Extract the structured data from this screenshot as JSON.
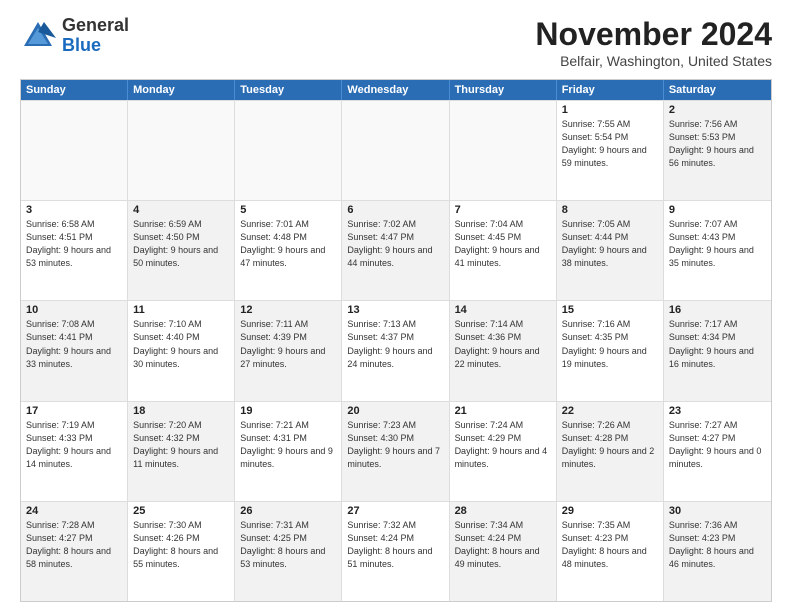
{
  "logo": {
    "general": "General",
    "blue": "Blue"
  },
  "title": "November 2024",
  "subtitle": "Belfair, Washington, United States",
  "days_of_week": [
    "Sunday",
    "Monday",
    "Tuesday",
    "Wednesday",
    "Thursday",
    "Friday",
    "Saturday"
  ],
  "weeks": [
    [
      {
        "day": "",
        "info": "",
        "empty": true
      },
      {
        "day": "",
        "info": "",
        "empty": true
      },
      {
        "day": "",
        "info": "",
        "empty": true
      },
      {
        "day": "",
        "info": "",
        "empty": true
      },
      {
        "day": "",
        "info": "",
        "empty": true
      },
      {
        "day": "1",
        "info": "Sunrise: 7:55 AM\nSunset: 5:54 PM\nDaylight: 9 hours and 59 minutes.",
        "alt": false
      },
      {
        "day": "2",
        "info": "Sunrise: 7:56 AM\nSunset: 5:53 PM\nDaylight: 9 hours and 56 minutes.",
        "alt": true
      }
    ],
    [
      {
        "day": "3",
        "info": "Sunrise: 6:58 AM\nSunset: 4:51 PM\nDaylight: 9 hours and 53 minutes.",
        "alt": false
      },
      {
        "day": "4",
        "info": "Sunrise: 6:59 AM\nSunset: 4:50 PM\nDaylight: 9 hours and 50 minutes.",
        "alt": true
      },
      {
        "day": "5",
        "info": "Sunrise: 7:01 AM\nSunset: 4:48 PM\nDaylight: 9 hours and 47 minutes.",
        "alt": false
      },
      {
        "day": "6",
        "info": "Sunrise: 7:02 AM\nSunset: 4:47 PM\nDaylight: 9 hours and 44 minutes.",
        "alt": true
      },
      {
        "day": "7",
        "info": "Sunrise: 7:04 AM\nSunset: 4:45 PM\nDaylight: 9 hours and 41 minutes.",
        "alt": false
      },
      {
        "day": "8",
        "info": "Sunrise: 7:05 AM\nSunset: 4:44 PM\nDaylight: 9 hours and 38 minutes.",
        "alt": true
      },
      {
        "day": "9",
        "info": "Sunrise: 7:07 AM\nSunset: 4:43 PM\nDaylight: 9 hours and 35 minutes.",
        "alt": false
      }
    ],
    [
      {
        "day": "10",
        "info": "Sunrise: 7:08 AM\nSunset: 4:41 PM\nDaylight: 9 hours and 33 minutes.",
        "alt": true
      },
      {
        "day": "11",
        "info": "Sunrise: 7:10 AM\nSunset: 4:40 PM\nDaylight: 9 hours and 30 minutes.",
        "alt": false
      },
      {
        "day": "12",
        "info": "Sunrise: 7:11 AM\nSunset: 4:39 PM\nDaylight: 9 hours and 27 minutes.",
        "alt": true
      },
      {
        "day": "13",
        "info": "Sunrise: 7:13 AM\nSunset: 4:37 PM\nDaylight: 9 hours and 24 minutes.",
        "alt": false
      },
      {
        "day": "14",
        "info": "Sunrise: 7:14 AM\nSunset: 4:36 PM\nDaylight: 9 hours and 22 minutes.",
        "alt": true
      },
      {
        "day": "15",
        "info": "Sunrise: 7:16 AM\nSunset: 4:35 PM\nDaylight: 9 hours and 19 minutes.",
        "alt": false
      },
      {
        "day": "16",
        "info": "Sunrise: 7:17 AM\nSunset: 4:34 PM\nDaylight: 9 hours and 16 minutes.",
        "alt": true
      }
    ],
    [
      {
        "day": "17",
        "info": "Sunrise: 7:19 AM\nSunset: 4:33 PM\nDaylight: 9 hours and 14 minutes.",
        "alt": false
      },
      {
        "day": "18",
        "info": "Sunrise: 7:20 AM\nSunset: 4:32 PM\nDaylight: 9 hours and 11 minutes.",
        "alt": true
      },
      {
        "day": "19",
        "info": "Sunrise: 7:21 AM\nSunset: 4:31 PM\nDaylight: 9 hours and 9 minutes.",
        "alt": false
      },
      {
        "day": "20",
        "info": "Sunrise: 7:23 AM\nSunset: 4:30 PM\nDaylight: 9 hours and 7 minutes.",
        "alt": true
      },
      {
        "day": "21",
        "info": "Sunrise: 7:24 AM\nSunset: 4:29 PM\nDaylight: 9 hours and 4 minutes.",
        "alt": false
      },
      {
        "day": "22",
        "info": "Sunrise: 7:26 AM\nSunset: 4:28 PM\nDaylight: 9 hours and 2 minutes.",
        "alt": true
      },
      {
        "day": "23",
        "info": "Sunrise: 7:27 AM\nSunset: 4:27 PM\nDaylight: 9 hours and 0 minutes.",
        "alt": false
      }
    ],
    [
      {
        "day": "24",
        "info": "Sunrise: 7:28 AM\nSunset: 4:27 PM\nDaylight: 8 hours and 58 minutes.",
        "alt": true
      },
      {
        "day": "25",
        "info": "Sunrise: 7:30 AM\nSunset: 4:26 PM\nDaylight: 8 hours and 55 minutes.",
        "alt": false
      },
      {
        "day": "26",
        "info": "Sunrise: 7:31 AM\nSunset: 4:25 PM\nDaylight: 8 hours and 53 minutes.",
        "alt": true
      },
      {
        "day": "27",
        "info": "Sunrise: 7:32 AM\nSunset: 4:24 PM\nDaylight: 8 hours and 51 minutes.",
        "alt": false
      },
      {
        "day": "28",
        "info": "Sunrise: 7:34 AM\nSunset: 4:24 PM\nDaylight: 8 hours and 49 minutes.",
        "alt": true
      },
      {
        "day": "29",
        "info": "Sunrise: 7:35 AM\nSunset: 4:23 PM\nDaylight: 8 hours and 48 minutes.",
        "alt": false
      },
      {
        "day": "30",
        "info": "Sunrise: 7:36 AM\nSunset: 4:23 PM\nDaylight: 8 hours and 46 minutes.",
        "alt": true
      }
    ]
  ]
}
